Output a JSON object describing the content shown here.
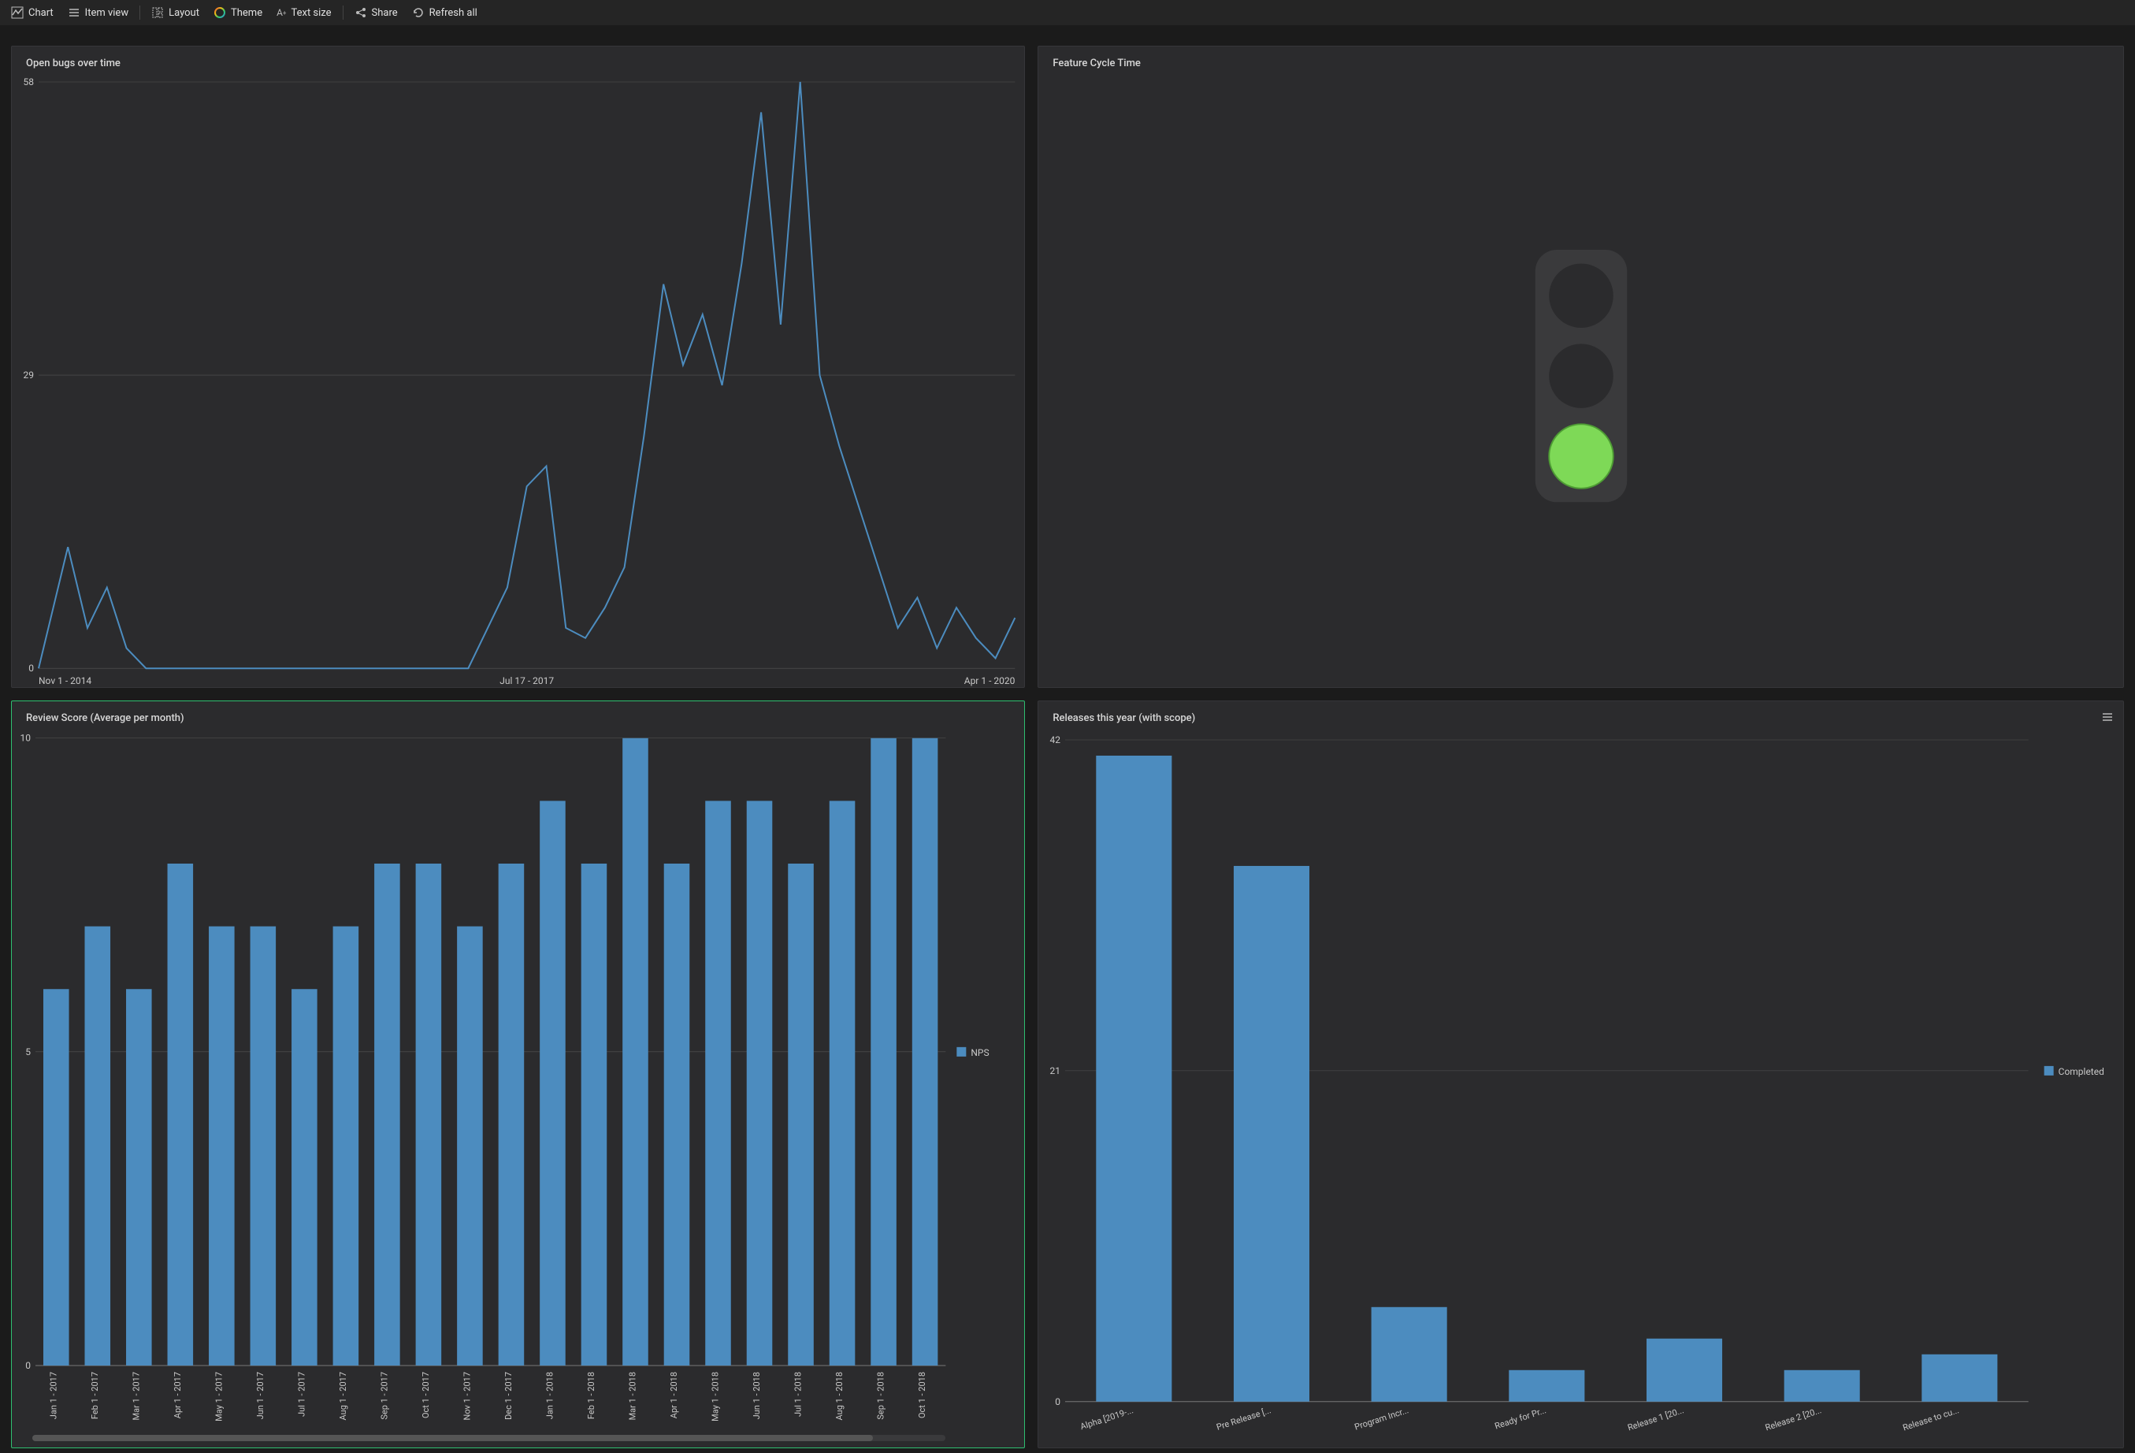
{
  "toolbar": {
    "chart": "Chart",
    "item_view": "Item view",
    "layout": "Layout",
    "theme": "Theme",
    "text_size": "Text size",
    "share": "Share",
    "refresh_all": "Refresh all"
  },
  "panels": {
    "bugs": {
      "title": "Open bugs over time"
    },
    "cycle": {
      "title": "Feature Cycle Time"
    },
    "review": {
      "title": "Review Score (Average per month)",
      "legend": "NPS"
    },
    "releases": {
      "title": "Releases this year (with scope)",
      "legend": "Completed"
    }
  },
  "chart_data": [
    {
      "id": "bugs",
      "type": "line",
      "title": "Open bugs over time",
      "y_ticks": [
        0,
        29,
        58
      ],
      "x_ticks": [
        "Nov 1 - 2014",
        "Jul 17 - 2017",
        "Apr 1 - 2020"
      ],
      "series": [
        {
          "name": "Open bugs",
          "x": [
            0,
            0.03,
            0.05,
            0.07,
            0.09,
            0.11,
            0.44,
            0.46,
            0.48,
            0.5,
            0.52,
            0.54,
            0.56,
            0.58,
            0.6,
            0.62,
            0.64,
            0.66,
            0.68,
            0.7,
            0.72,
            0.74,
            0.76,
            0.78,
            0.8,
            0.82,
            0.84,
            0.86,
            0.88,
            0.9,
            0.92,
            0.94,
            0.96,
            0.98,
            1.0
          ],
          "y": [
            0,
            12,
            4,
            8,
            2,
            0,
            0,
            4,
            8,
            18,
            20,
            4,
            3,
            6,
            10,
            23,
            38,
            30,
            35,
            28,
            40,
            55,
            34,
            58,
            29,
            22,
            16,
            10,
            4,
            7,
            2,
            6,
            3,
            1,
            5
          ]
        }
      ],
      "ylim": [
        0,
        58
      ]
    },
    {
      "id": "review",
      "type": "bar",
      "title": "Review Score (Average per month)",
      "categories": [
        "Jan 1 - 2017",
        "Feb 1 - 2017",
        "Mar 1 - 2017",
        "Apr 1 - 2017",
        "May 1 - 2017",
        "Jun 1 - 2017",
        "Jul 1 - 2017",
        "Aug 1 - 2017",
        "Sep 1 - 2017",
        "Oct 1 - 2017",
        "Nov 1 - 2017",
        "Dec 1 - 2017",
        "Jan 1 - 2018",
        "Feb 1 - 2018",
        "Mar 1 - 2018",
        "Apr 1 - 2018",
        "May 1 - 2018",
        "Jun 1 - 2018",
        "Jul 1 - 2018",
        "Aug 1 - 2018",
        "Sep 1 - 2018",
        "Oct 1 - 2018"
      ],
      "series": [
        {
          "name": "NPS",
          "values": [
            6,
            7,
            6,
            8,
            7,
            7,
            6,
            7,
            8,
            8,
            7,
            8,
            9,
            8,
            10,
            8,
            9,
            9,
            8,
            9,
            10,
            10
          ]
        }
      ],
      "y_ticks": [
        0,
        5,
        10
      ],
      "ylim": [
        0,
        10
      ]
    },
    {
      "id": "releases",
      "type": "bar",
      "title": "Releases this year (with scope)",
      "categories": [
        "Alpha [2019-...",
        "Pre Release [...",
        "Program Incr...",
        "Ready for Pr...",
        "Release 1 [20...",
        "Release 2 [20...",
        "Release to cu..."
      ],
      "series": [
        {
          "name": "Completed",
          "values": [
            41,
            34,
            6,
            2,
            4,
            2,
            3
          ]
        }
      ],
      "y_ticks": [
        0,
        21,
        42
      ],
      "ylim": [
        0,
        42
      ]
    }
  ]
}
